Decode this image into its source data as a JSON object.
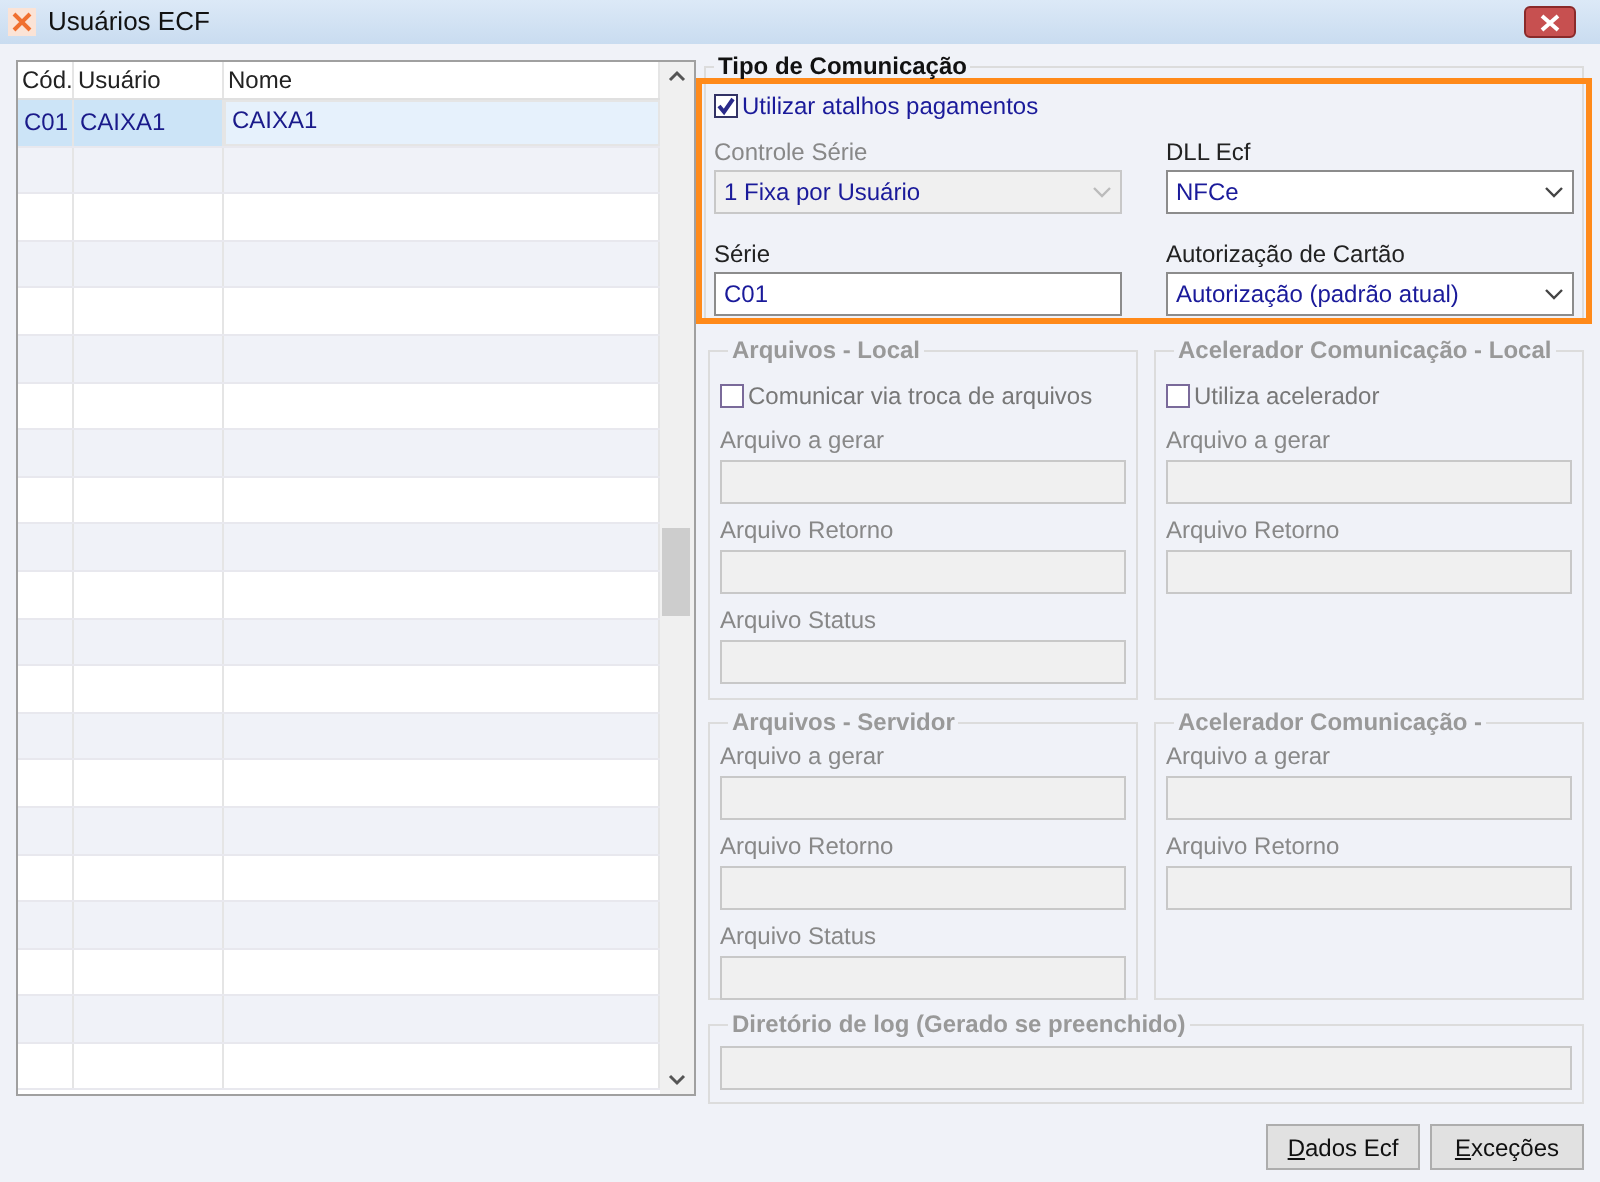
{
  "window": {
    "title": "Usuários ECF"
  },
  "grid": {
    "columns": [
      "Cód.",
      "Usuário",
      "Nome"
    ],
    "rows": [
      {
        "cells": [
          "C01",
          "CAIXA1",
          "CAIXA1"
        ],
        "selected": true
      }
    ]
  },
  "tipo_comunicacao": {
    "title": "Tipo de Comunicação",
    "highlighted": true,
    "checkbox": {
      "label": "Utilizar atalhos pagamentos",
      "checked": true
    },
    "fields": [
      {
        "label": "Controle Série",
        "value": "1 Fixa por Usuário",
        "kind": "combo",
        "disabled": true
      },
      {
        "label": "DLL Ecf",
        "value": "NFCe",
        "kind": "combo",
        "disabled": false
      },
      {
        "label": "Série",
        "value": "C01",
        "kind": "text",
        "disabled": false
      },
      {
        "label": "Autorização de Cartão",
        "value": "Autorização (padrão atual)",
        "kind": "combo",
        "disabled": false
      }
    ]
  },
  "groups": [
    {
      "title": "Arquivos - Local",
      "disabled": true,
      "checkbox": {
        "label": "Comunicar via troca de arquivos",
        "checked": false
      },
      "fields": [
        "Arquivo a gerar",
        "Arquivo Retorno",
        "Arquivo Status"
      ]
    },
    {
      "title": "Acelerador Comunicação - Local",
      "disabled": true,
      "checkbox": {
        "label": "Utiliza acelerador",
        "checked": false
      },
      "fields": [
        "Arquivo a gerar",
        "Arquivo Retorno"
      ]
    },
    {
      "title": "Arquivos - Servidor",
      "disabled": true,
      "fields": [
        "Arquivo a gerar",
        "Arquivo Retorno",
        "Arquivo Status"
      ]
    },
    {
      "title": "Acelerador Comunicação -",
      "disabled": true,
      "fields": [
        "Arquivo a gerar",
        "Arquivo Retorno"
      ]
    }
  ],
  "log": {
    "title": "Diretório de log (Gerado se preenchido)",
    "disabled": true
  },
  "buttons": [
    "Dados Ecf",
    "Exceções"
  ]
}
